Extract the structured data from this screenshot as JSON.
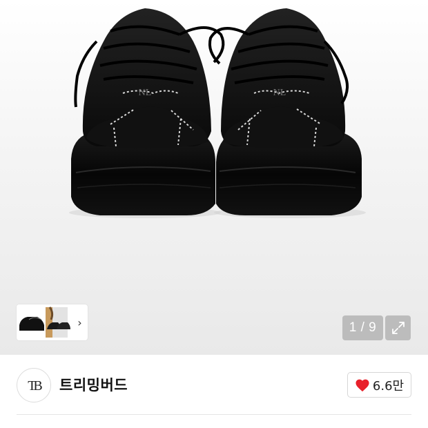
{
  "gallery": {
    "image_alt": "",
    "counter": "1 / 9",
    "thumb_next_icon": "chevron-right-icon",
    "expand_icon": "expand-arrows-icon"
  },
  "brand": {
    "logo_text": "TB",
    "name": "트리밍버드"
  },
  "like": {
    "icon": "heart-icon",
    "color": "#e8202a",
    "count": "6.6만"
  },
  "colors": {
    "shoe": "#0e0e0e",
    "stitch": "#d8d8d8"
  }
}
